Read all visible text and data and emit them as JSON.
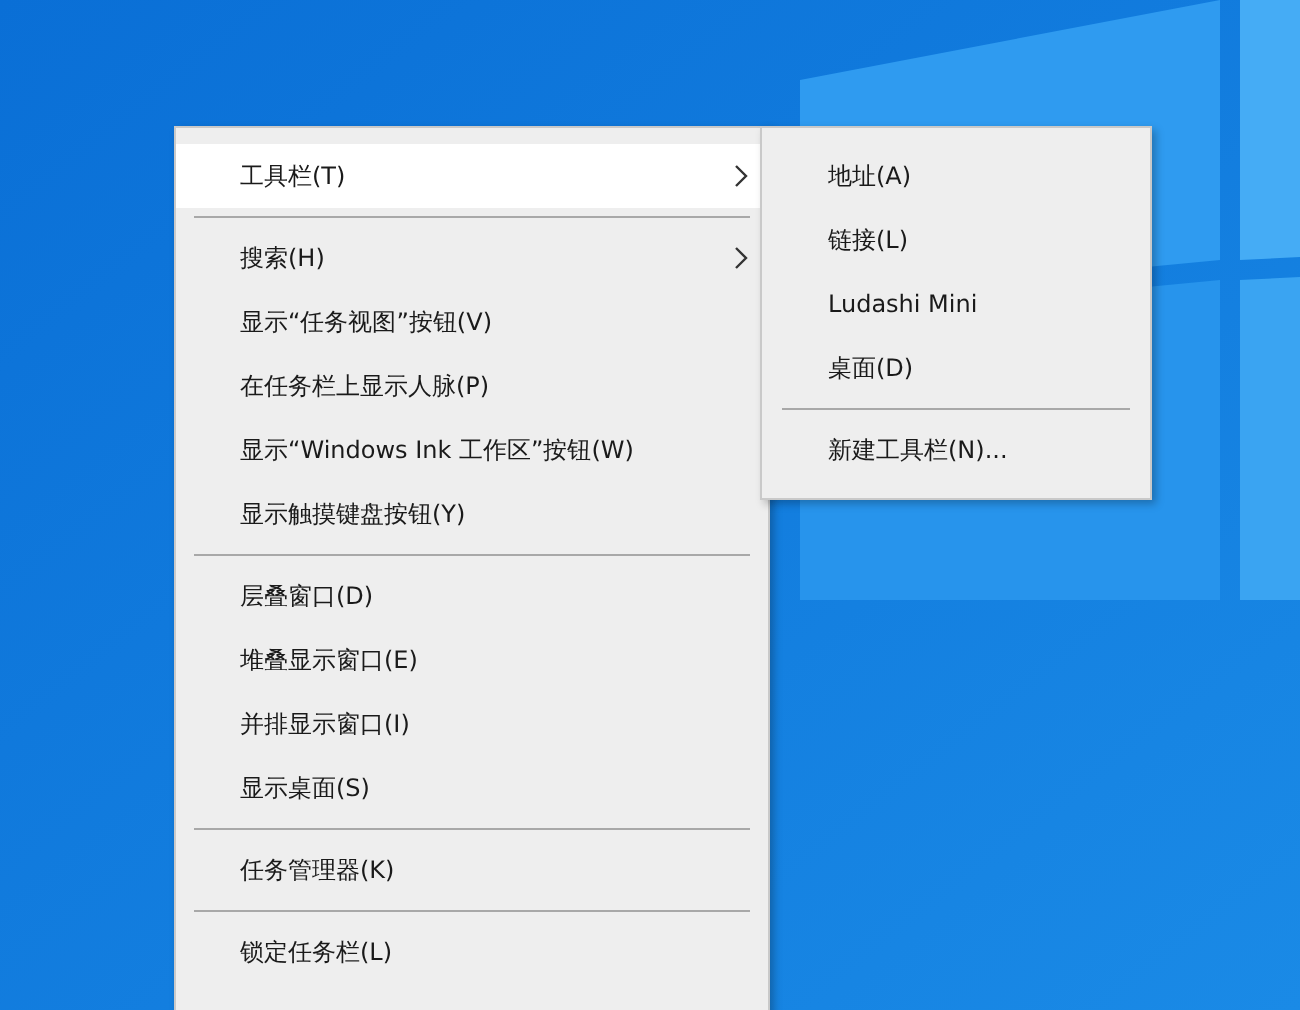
{
  "context_menu": {
    "items": [
      {
        "kind": "item",
        "label": "工具栏(T)",
        "has_submenu": true,
        "selected": true
      },
      {
        "kind": "separator"
      },
      {
        "kind": "item",
        "label": "搜索(H)",
        "has_submenu": true,
        "selected": false
      },
      {
        "kind": "item",
        "label": "显示“任务视图”按钮(V)",
        "has_submenu": false,
        "selected": false
      },
      {
        "kind": "item",
        "label": "在任务栏上显示人脉(P)",
        "has_submenu": false,
        "selected": false
      },
      {
        "kind": "item",
        "label": "显示“Windows Ink 工作区”按钮(W)",
        "has_submenu": false,
        "selected": false
      },
      {
        "kind": "item",
        "label": "显示触摸键盘按钮(Y)",
        "has_submenu": false,
        "selected": false
      },
      {
        "kind": "separator"
      },
      {
        "kind": "item",
        "label": "层叠窗口(D)",
        "has_submenu": false,
        "selected": false
      },
      {
        "kind": "item",
        "label": "堆叠显示窗口(E)",
        "has_submenu": false,
        "selected": false
      },
      {
        "kind": "item",
        "label": "并排显示窗口(I)",
        "has_submenu": false,
        "selected": false
      },
      {
        "kind": "item",
        "label": "显示桌面(S)",
        "has_submenu": false,
        "selected": false
      },
      {
        "kind": "separator"
      },
      {
        "kind": "item",
        "label": "任务管理器(K)",
        "has_submenu": false,
        "selected": false
      },
      {
        "kind": "separator"
      },
      {
        "kind": "item",
        "label": "锁定任务栏(L)",
        "has_submenu": false,
        "selected": false
      }
    ]
  },
  "submenu": {
    "items": [
      {
        "kind": "item",
        "label": "地址(A)",
        "has_submenu": false,
        "selected": false
      },
      {
        "kind": "item",
        "label": "链接(L)",
        "has_submenu": false,
        "selected": false
      },
      {
        "kind": "item",
        "label": "Ludashi Mini",
        "has_submenu": false,
        "selected": false
      },
      {
        "kind": "item",
        "label": "桌面(D)",
        "has_submenu": false,
        "selected": false
      },
      {
        "kind": "separator"
      },
      {
        "kind": "item",
        "label": "新建工具栏(N)...",
        "has_submenu": false,
        "selected": false
      }
    ]
  }
}
